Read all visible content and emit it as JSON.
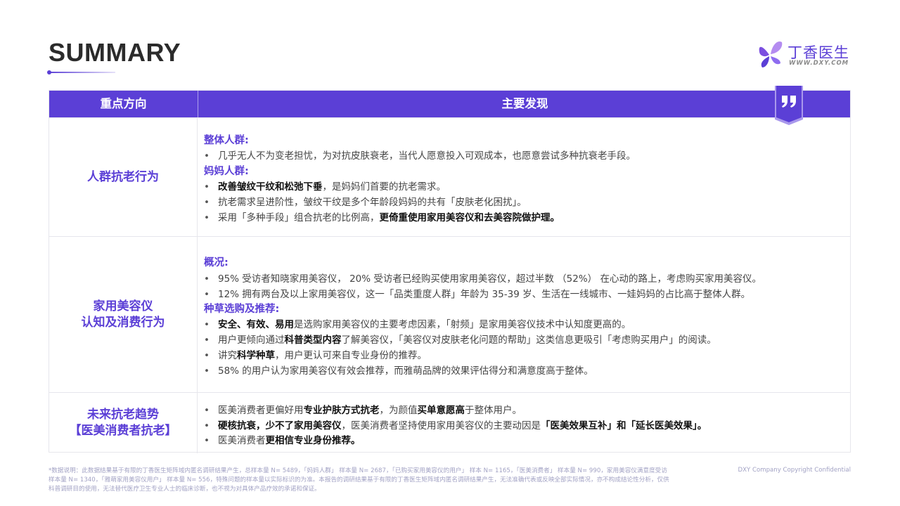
{
  "header": {
    "title": "SUMMARY",
    "logo_text": "丁香医生",
    "logo_url": "WWW.DXY.COM"
  },
  "colors": {
    "accent": "#5b3fd6",
    "row_border": "#e6e6ec",
    "footnote": "#a2a2c4"
  },
  "table": {
    "col_direction": "重点方向",
    "col_findings": "主要发现",
    "quote_icon": "quote-icon",
    "rows": [
      {
        "direction": [
          "人群抗老行为"
        ],
        "s1_head": "整体人群:",
        "s1_b1": "几乎无人不为变老担忧，为对抗皮肤衰老，当代人愿意投入可观成本，也愿意尝试多种抗衰老手段。",
        "s2_head": "妈妈人群:",
        "s2_b1_bold": "改善皱纹干纹和松弛下垂",
        "s2_b1_rest": "，是妈妈们首要的抗老需求。",
        "s2_b2": "抗老需求呈进阶性，皱纹干纹是多个年龄段妈妈的共有「皮肤老化困扰」。",
        "s2_b3_pre": "采用「多种手段」组合抗老的比例高，",
        "s2_b3_bold": "更倚重使用家用美容仪和去美容院做护理。"
      },
      {
        "direction": [
          "家用美容仪",
          "认知及消费行为"
        ],
        "s1_head": "概况:",
        "s1_b1": "95% 受访者知晓家用美容仪， 20% 受访者已经购买使用家用美容仪，超过半数 （52%） 在心动的路上，考虑购买家用美容仪。",
        "s1_b2": "12% 拥有两台及以上家用美容仪，这一「品类重度人群」年龄为 35-39 岁、生活在一线城市、一娃妈妈的占比高于整体人群。",
        "s2_head": "种草选购及推荐:",
        "s2_b1_bold": "安全、有效、易用",
        "s2_b1_rest": "是选购家用美容仪的主要考虑因素，「射频」是家用美容仪技术中认知度更高的。",
        "s2_b2_pre": "用户更倾向通过",
        "s2_b2_bold": "科普类型内容",
        "s2_b2_rest": "了解美容仪，「美容仪对皮肤老化问题的帮助」这类信息更吸引「考虑购买用户」的阅读。",
        "s2_b3_pre": "讲究",
        "s2_b3_bold": "科学种草",
        "s2_b3_rest": "，用户更认可来自专业身份的推荐。",
        "s2_b4": "58% 的用户认为家用美容仪有效会推荐，而雅萌品牌的效果评估得分和满意度高于整体。"
      },
      {
        "direction": [
          "未来抗老趋势",
          "【医美消费者抗老】"
        ],
        "b1_pre": "医美消费者更偏好用",
        "b1_bold": "专业护肤方式抗老",
        "b1_mid": "，为颜值",
        "b1_bold2": "买单意愿高",
        "b1_rest": "于整体用户。",
        "b2_bold": "硬核抗衰，少不了家用美容仪",
        "b2_mid": "，医美消费者坚持使用家用美容仪的主要动因是",
        "b2_bold2": "「医美效果互补」和「延长医美效果」。",
        "b3_pre": "医美消费者",
        "b3_bold": "更相信专业身份推荐。"
      }
    ]
  },
  "footer": {
    "note_line1": "*数据说明：此数据结果基于有限的丁香医生矩阵域内匿名调研结果产生，总样本量 N= 5489，「妈妈人群」 样本量 N= 2687，「已购买家用美容仪的用户」 样本 N= 1165，「医美消费者」 样本量 N= 990，家用美容仪满意度受访",
    "note_line2": "样本量 N= 1340，「雅萌家用美容仪用户」 样本量 N= 556，特殊问题的样本量以实际标识的为准。本报告的调研结果基于有限的丁香医生矩阵域内匿名调研结果产生，无法准确代表或反映全部实际情况，亦不构成结论性分析，仅供",
    "note_line3": "科普调研目的使用，无法替代医疗卫生专业人士的临床诊断，也不视为对具体产品疗效的承诺和保证。",
    "copyright": "DXY Company Copyright Confidential"
  }
}
